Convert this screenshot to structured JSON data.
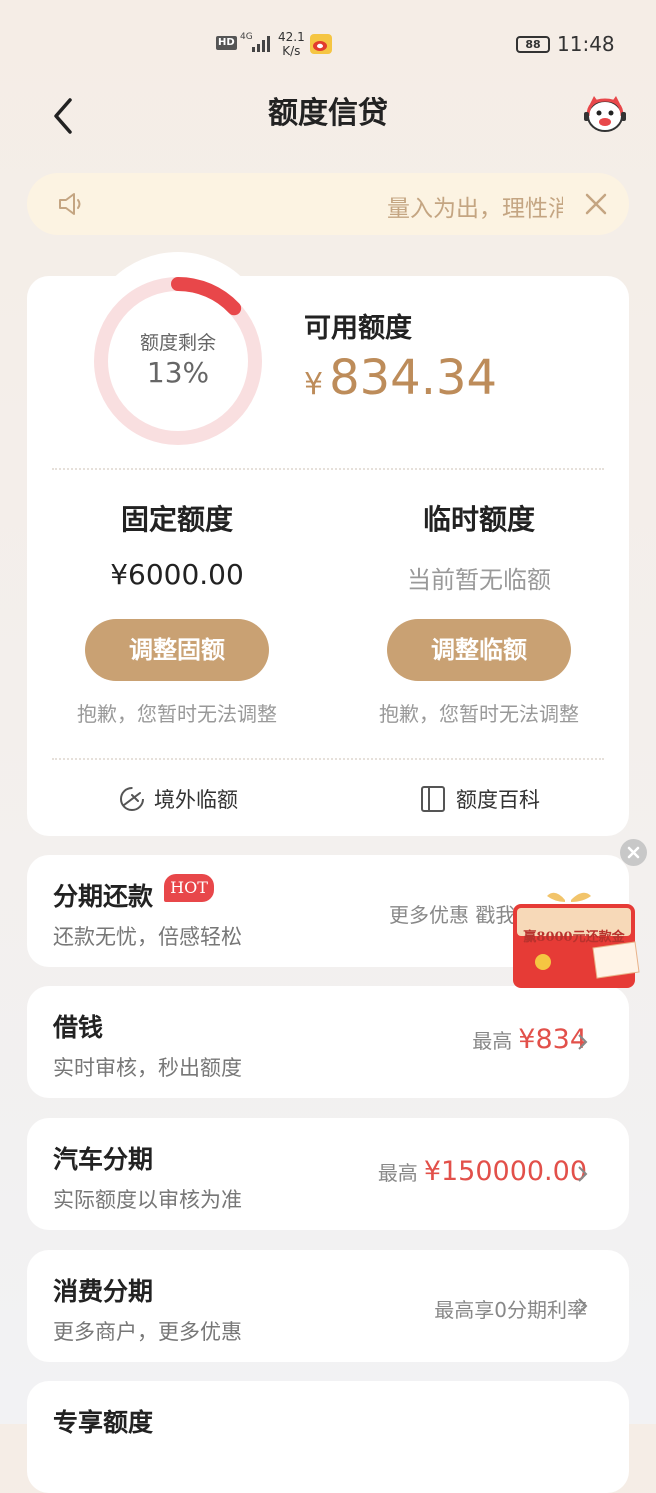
{
  "status_bar": {
    "hd": "HD",
    "network": "4G",
    "speed_value": "42.1",
    "speed_unit": "K/s",
    "battery": "88",
    "time": "11:48"
  },
  "header": {
    "title": "额度信贷"
  },
  "notice": {
    "text": "量入为出，理性消费"
  },
  "credit": {
    "ring_label": "额度剩余",
    "ring_percent": "13%",
    "ring_fraction": 0.13,
    "available_label": "可用额度",
    "available_currency": "¥",
    "available_amount": "834.34",
    "fixed": {
      "title": "固定额度",
      "value": "¥6000.00",
      "button": "调整固额",
      "note": "抱歉，您暂时无法调整"
    },
    "temp": {
      "title": "临时额度",
      "value": "当前暂无临额",
      "button": "调整临额",
      "note": "抱歉，您暂时无法调整"
    },
    "links": {
      "overseas": "境外临额",
      "wiki": "额度百科"
    }
  },
  "items": [
    {
      "title": "分期还款",
      "badge": "HOT",
      "subtitle": "还款无忧，倍感轻松",
      "right_text": "更多优惠 戳我参与"
    },
    {
      "title": "借钱",
      "subtitle": "实时审核，秒出额度",
      "right_prefix": "最高",
      "right_amount": "¥834"
    },
    {
      "title": "汽车分期",
      "subtitle": "实际额度以审核为准",
      "right_prefix": "最高",
      "right_amount": "¥150000.00"
    },
    {
      "title": "消费分期",
      "subtitle": "更多商户，更多优惠",
      "right_text": "最高享0分期利率"
    },
    {
      "title": "专享额度"
    }
  ],
  "promo": {
    "text": "赢8000元还款金"
  },
  "colors": {
    "gold": "#c9a173",
    "amount_gold": "#bd8c5a",
    "red": "#e2504a",
    "ring_bg": "#f9dfe0",
    "ring_fg": "#e8474a"
  }
}
